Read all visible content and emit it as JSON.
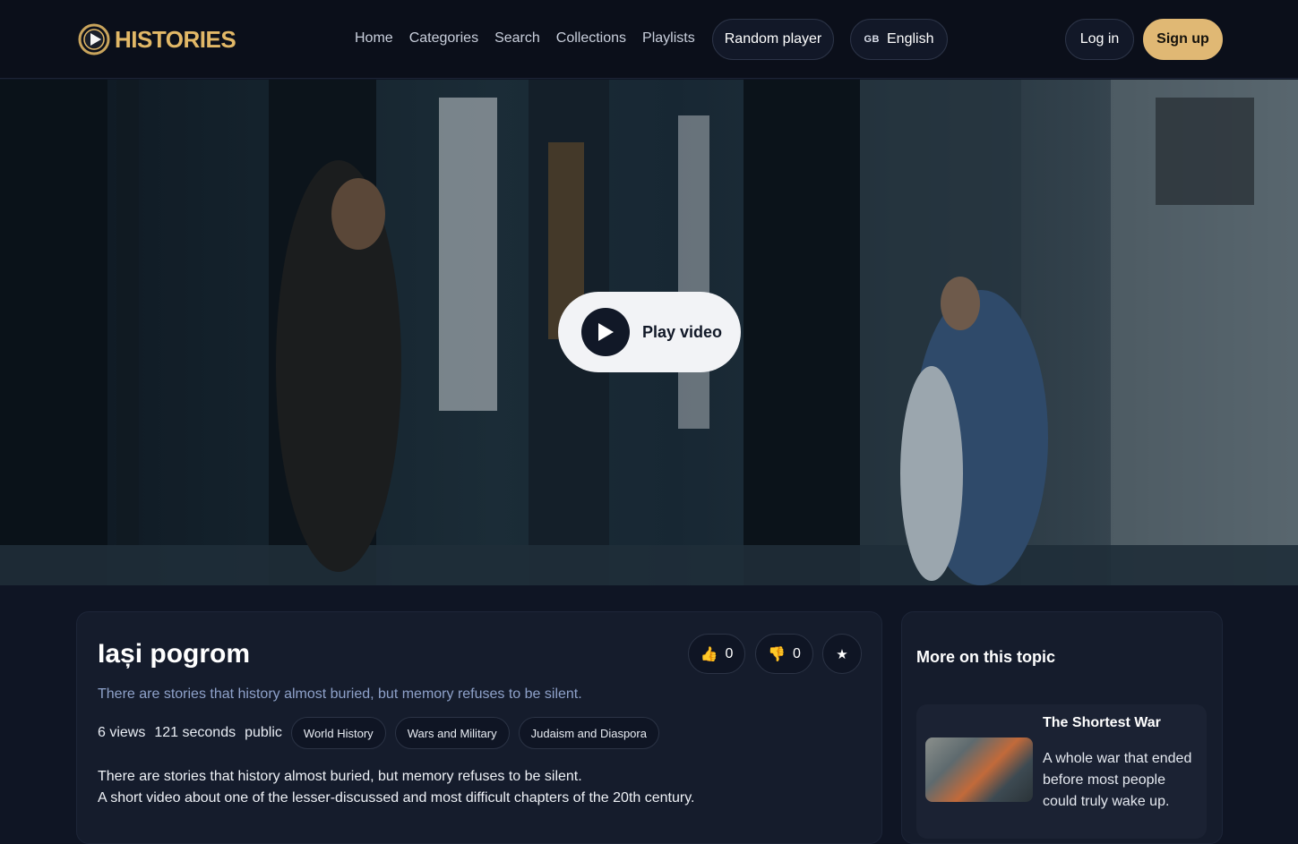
{
  "header": {
    "brand": "HISTORIES",
    "nav": [
      "Home",
      "Categories",
      "Search",
      "Collections",
      "Playlists"
    ],
    "random_player": "Random player",
    "language": {
      "code": "GB",
      "label": "English"
    },
    "login": "Log in",
    "signup": "Sign up"
  },
  "hero": {
    "play_label": "Play video"
  },
  "video": {
    "title": "Iași pogrom",
    "subtitle": "There are stories that history almost buried, but memory refuses to be silent.",
    "likes": "0",
    "dislikes": "0",
    "views": "6 views",
    "duration": "121 seconds",
    "visibility": "public",
    "tags": [
      "World History",
      "Wars and Military",
      "Judaism and Diaspora"
    ],
    "description": [
      "There are stories that history almost buried, but memory refuses to be silent.",
      "A short video about one of the lesser-discussed and most difficult chapters of the 20th century."
    ]
  },
  "related": {
    "heading": "More on this topic",
    "items": [
      {
        "title": "The Shortest War",
        "description": "A whole war that ended before most people could truly wake up."
      }
    ]
  },
  "colors": {
    "accent": "#e0b874",
    "background": "#0f1524",
    "card": "#151c2c"
  }
}
